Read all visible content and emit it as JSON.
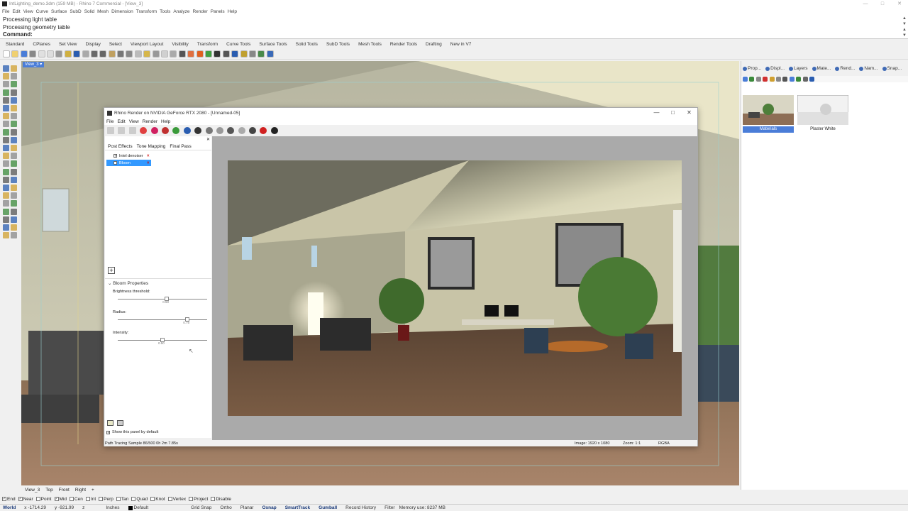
{
  "app": {
    "title": "IntLighting_demo.3dm (159 MB) - Rhino 7 Commercial - [View_3]"
  },
  "window_controls": [
    "—",
    "□",
    "✕"
  ],
  "menu": [
    "File",
    "Edit",
    "View",
    "Curve",
    "Surface",
    "SubD",
    "Solid",
    "Mesh",
    "Dimension",
    "Transform",
    "Tools",
    "Analyze",
    "Render",
    "Panels",
    "Help"
  ],
  "command_history": [
    "Processing light table",
    "Processing geometry table"
  ],
  "command_prompt": "Command:",
  "toolbar_tabs": [
    "Standard",
    "CPlanes",
    "Set View",
    "Display",
    "Select",
    "Viewport Layout",
    "Visibility",
    "Transform",
    "Curve Tools",
    "Surface Tools",
    "Solid Tools",
    "SubD Tools",
    "Mesh Tools",
    "Render Tools",
    "Drafting",
    "New in V7"
  ],
  "viewport": {
    "label": "View_3"
  },
  "view_tabs": [
    "View_3",
    "Top",
    "Front",
    "Right"
  ],
  "view_tab_add": "+",
  "osnaps": [
    {
      "label": "End",
      "on": true
    },
    {
      "label": "Near",
      "on": true
    },
    {
      "label": "Point",
      "on": false
    },
    {
      "label": "Mid",
      "on": true
    },
    {
      "label": "Cen",
      "on": false
    },
    {
      "label": "Int",
      "on": false
    },
    {
      "label": "Perp",
      "on": false
    },
    {
      "label": "Tan",
      "on": false
    },
    {
      "label": "Quad",
      "on": false
    },
    {
      "label": "Knot",
      "on": false
    },
    {
      "label": "Vertex",
      "on": false
    },
    {
      "label": "Project",
      "on": false
    },
    {
      "label": "Disable",
      "on": false
    }
  ],
  "status": {
    "cplane": "World",
    "x": "x -1714.29",
    "y": "y -921.99",
    "z": "z",
    "units": "Inches",
    "layer": "Default",
    "grid_snap": "Grid Snap",
    "ortho": "Ortho",
    "planar": "Planar",
    "osnap": "Osnap",
    "smarttrack": "SmartTrack",
    "gumball": "Gumball",
    "record_history": "Record History",
    "filter": "Filter",
    "memory": "Memory use: 8237 MB"
  },
  "right_panel": {
    "tabs": [
      "Prop...",
      "Displ...",
      "Layers",
      "Mate...",
      "Rend...",
      "Nam...",
      "Snap..."
    ],
    "materials": [
      "Materials",
      "Plaster White"
    ]
  },
  "render_window": {
    "title": "Rhino Render on NVIDIA GeForce RTX 2080 - [Unnamed-05]",
    "menu": [
      "File",
      "Edit",
      "View",
      "Render",
      "Help"
    ],
    "panel_tabs": [
      "Post Effects",
      "Tone Mapping",
      "Final Pass"
    ],
    "effects": [
      {
        "label": "Intel denoiser",
        "checked": true,
        "selected": false
      },
      {
        "label": "Bloom",
        "checked": true,
        "selected": true
      }
    ],
    "add_button": "+",
    "bloom_header": "Bloom Properties",
    "sliders": [
      {
        "label": "Brightness threshold:",
        "value": "0.50",
        "position": 0.55
      },
      {
        "label": "Radius:",
        "value": "0.75",
        "position": 0.78
      },
      {
        "label": "Intensity:",
        "value": "0.50",
        "position": 0.5
      }
    ],
    "show_panel_default": "Show this panel by default",
    "status_left": "Path Tracing Sample 86/500 0h 2m 7.85s",
    "image_size": "Image: 1920 x 1080",
    "zoom": "Zoom: 1:1",
    "channel": "RGBA"
  },
  "colors": {
    "accent": "#3399ff",
    "selection": "#4a7dd8",
    "osnap_highlight": "#1a3a7a"
  }
}
